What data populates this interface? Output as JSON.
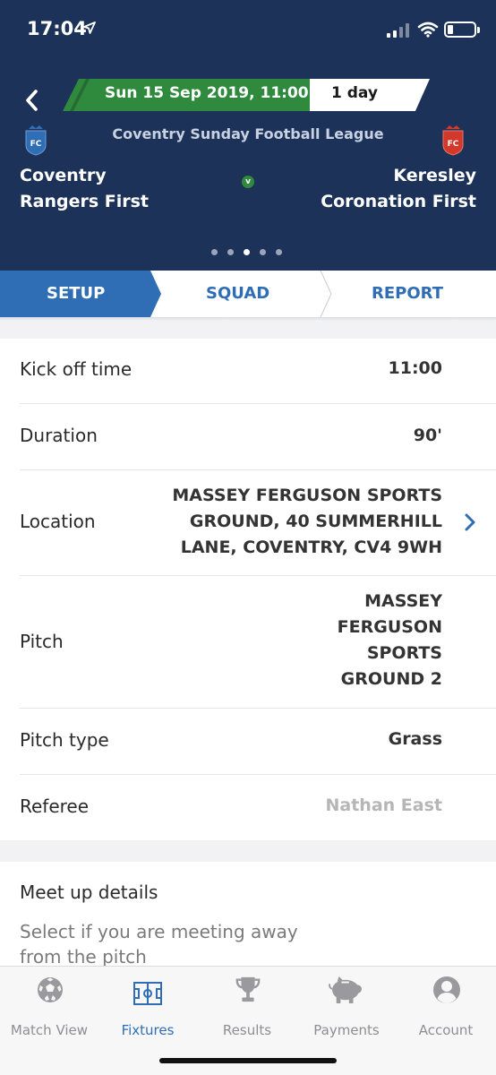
{
  "status_bar": {
    "time": "17:04"
  },
  "match": {
    "date_time": "Sun 15 Sep 2019, 11:00",
    "countdown": "1 day",
    "league": "Coventry Sunday Football League",
    "home_team": {
      "line1": "Coventry",
      "line2": "Rangers First",
      "crest_text": "FC",
      "crest_color": "#2f6eb5"
    },
    "away_team": {
      "line1": "Keresley",
      "line2": "Coronation First",
      "crest_text": "FC",
      "crest_color": "#d2392b"
    },
    "vs": "v",
    "pager": {
      "count": 5,
      "active_index": 2
    }
  },
  "tabs": [
    {
      "label": "SETUP",
      "active": true
    },
    {
      "label": "SQUAD",
      "active": false
    },
    {
      "label": "REPORT",
      "active": false
    }
  ],
  "details": {
    "kick_off": {
      "label": "Kick off time",
      "value": "11:00"
    },
    "duration": {
      "label": "Duration",
      "value": "90'"
    },
    "location": {
      "label": "Location",
      "lines": [
        "MASSEY FERGUSON SPORTS",
        "GROUND, 40 SUMMERHILL",
        "LANE, COVENTRY, CV4 9WH"
      ]
    },
    "pitch": {
      "label": "Pitch",
      "lines": [
        "MASSEY",
        "FERGUSON",
        "SPORTS",
        "GROUND 2"
      ]
    },
    "pitch_type": {
      "label": "Pitch type",
      "value": "Grass"
    },
    "referee": {
      "label": "Referee",
      "value": "Nathan East"
    }
  },
  "meet_up": {
    "title": "Meet up details",
    "description_line1": "Select if you are meeting away",
    "description_line2": "from the pitch"
  },
  "nav": [
    {
      "label": "Match View",
      "icon": "football-icon",
      "active": false
    },
    {
      "label": "Fixtures",
      "icon": "pitch-icon",
      "active": true
    },
    {
      "label": "Results",
      "icon": "trophy-icon",
      "active": false
    },
    {
      "label": "Payments",
      "icon": "piggy-bank-icon",
      "active": false
    },
    {
      "label": "Account",
      "icon": "user-icon",
      "active": false
    }
  ],
  "colors": {
    "header_bg": "#1d3258",
    "accent_blue": "#2f6eb5",
    "accent_green": "#2f8a3e"
  }
}
